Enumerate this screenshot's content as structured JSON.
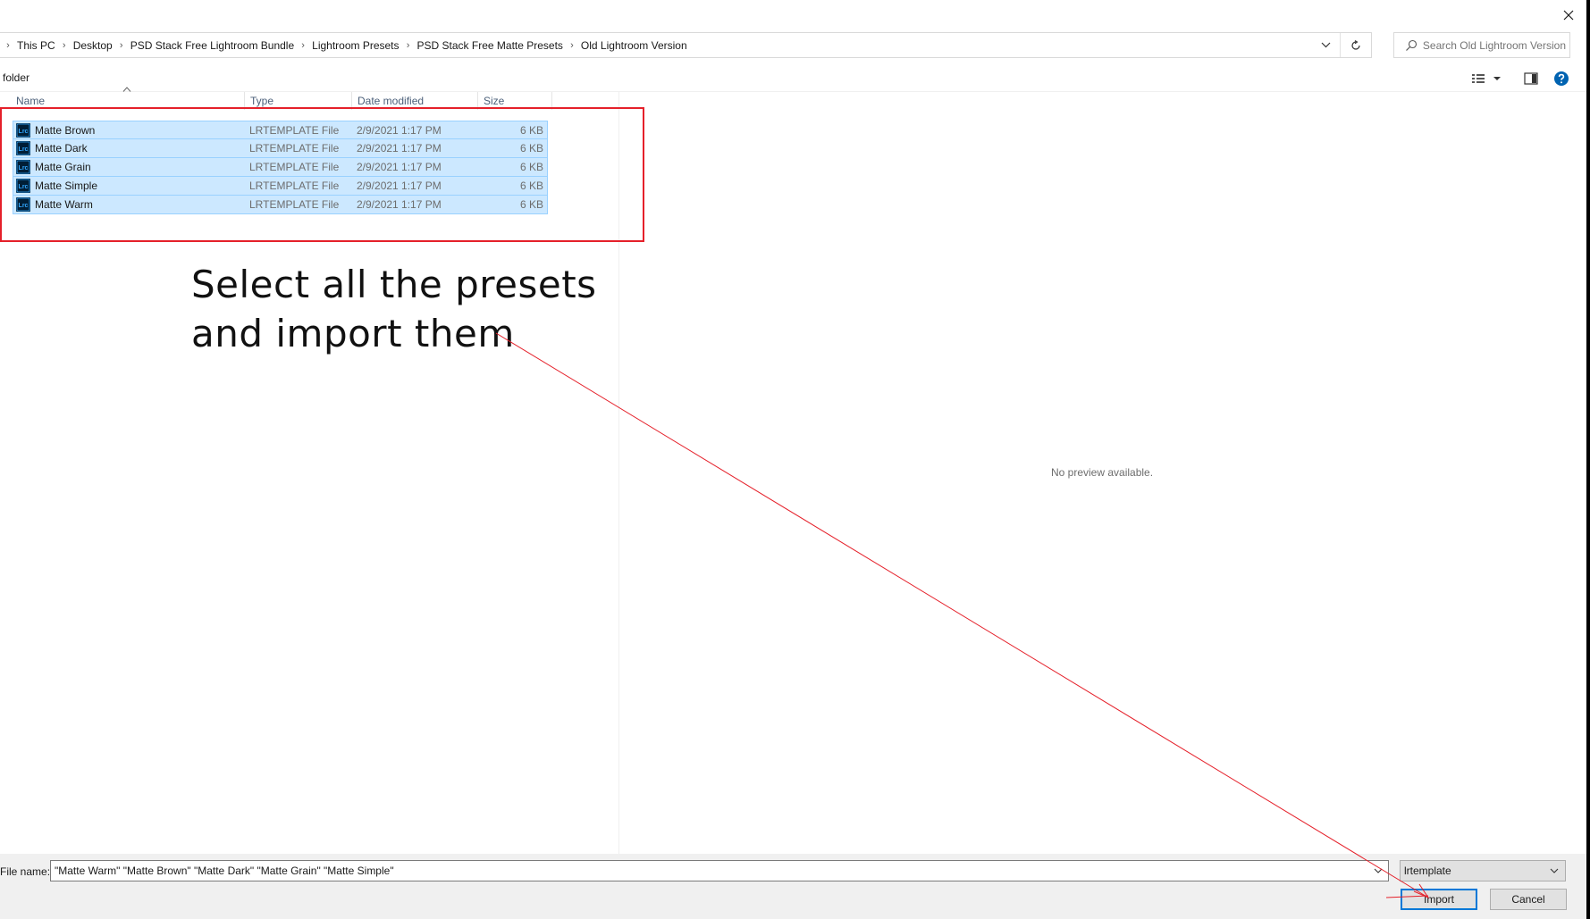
{
  "window": {
    "close_icon": "close-icon"
  },
  "address": {
    "crumbs": [
      "This PC",
      "Desktop",
      "PSD Stack Free Lightroom Bundle",
      "Lightroom Presets",
      "PSD Stack Free Matte Presets",
      "Old Lightroom Version"
    ],
    "dropdown_icon": "chevron-down-icon",
    "refresh_icon": "refresh-icon"
  },
  "search": {
    "placeholder": "Search Old Lightroom Version",
    "icon": "search-icon"
  },
  "toolbar": {
    "new_folder_label": "folder",
    "view_icon": "details-view-icon",
    "pane_icon": "preview-pane-icon",
    "help_icon": "help-icon"
  },
  "columns": {
    "name": "Name",
    "type": "Type",
    "date": "Date modified",
    "size": "Size"
  },
  "files": [
    {
      "icon": "lrc-file-icon",
      "name": "Matte Brown",
      "type": "LRTEMPLATE File",
      "date": "2/9/2021 1:17 PM",
      "size": "6 KB"
    },
    {
      "icon": "lrc-file-icon",
      "name": "Matte Dark",
      "type": "LRTEMPLATE File",
      "date": "2/9/2021 1:17 PM",
      "size": "6 KB"
    },
    {
      "icon": "lrc-file-icon",
      "name": "Matte Grain",
      "type": "LRTEMPLATE File",
      "date": "2/9/2021 1:17 PM",
      "size": "6 KB"
    },
    {
      "icon": "lrc-file-icon",
      "name": "Matte Simple",
      "type": "LRTEMPLATE File",
      "date": "2/9/2021 1:17 PM",
      "size": "6 KB"
    },
    {
      "icon": "lrc-file-icon",
      "name": "Matte Warm",
      "type": "LRTEMPLATE File",
      "date": "2/9/2021 1:17 PM",
      "size": "6 KB"
    }
  ],
  "preview": {
    "text": "No preview available."
  },
  "annotation": {
    "line1": "Select all the presets",
    "line2": "and import them",
    "color": "#e5202a"
  },
  "bottom": {
    "file_name_label": "File name:",
    "file_name_value": "\"Matte Warm\" \"Matte Brown\" \"Matte Dark\" \"Matte Grain\" \"Matte Simple\"",
    "file_type": "lrtemplate",
    "import_label": "Import",
    "cancel_label": "Cancel"
  },
  "colors": {
    "selection_fill": "#cce8ff",
    "selection_border": "#99d1ff",
    "accent": "#0078d7"
  }
}
